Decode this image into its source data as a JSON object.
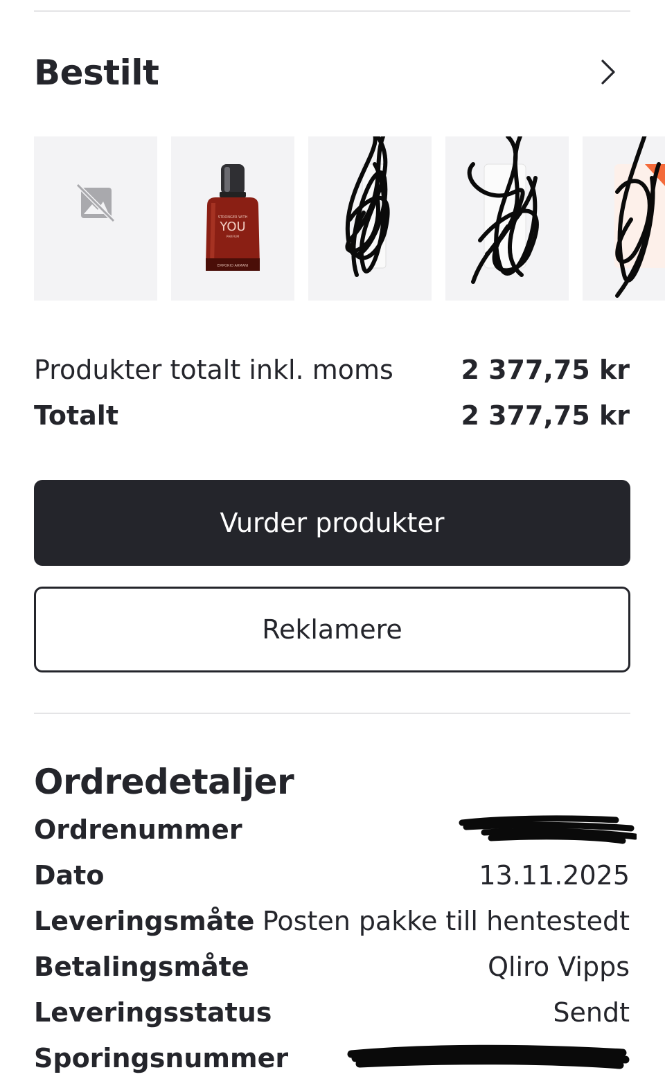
{
  "ordered_section": {
    "title": "Bestilt",
    "products": [
      {
        "name": "no-image-placeholder"
      },
      {
        "name": "perfume-bottle",
        "label_small": "STRONGER WITH",
        "label_big": "YOU",
        "label_sub": "PARFUM",
        "brand": "EMPORIO ARMANI"
      },
      {
        "name": "product-redacted"
      },
      {
        "name": "product-redacted"
      },
      {
        "name": "product-redacted"
      }
    ]
  },
  "summary": {
    "subtotal_label": "Produkter totalt inkl. moms",
    "subtotal_value": "2 377,75 kr",
    "total_label": "Totalt",
    "total_value": "2 377,75 kr"
  },
  "actions": {
    "review_label": "Vurder produkter",
    "complaint_label": "Reklamere"
  },
  "order_details": {
    "title": "Ordredetaljer",
    "rows": [
      {
        "key": "Ordrenummer",
        "value": ""
      },
      {
        "key": "Dato",
        "value": "13.11.2025"
      },
      {
        "key": "Leveringsmåte",
        "value": "Posten pakke till hentestedt"
      },
      {
        "key": "Betalingsmåte",
        "value": "Qliro Vipps"
      },
      {
        "key": "Leveringsstatus",
        "value": "Sendt"
      },
      {
        "key": "Sporingsnummer",
        "value": ""
      }
    ]
  },
  "colors": {
    "text": "#24252b",
    "button_dark": "#24252b",
    "thumb_bg": "#f3f3f5",
    "divider": "#e4e4e6"
  }
}
